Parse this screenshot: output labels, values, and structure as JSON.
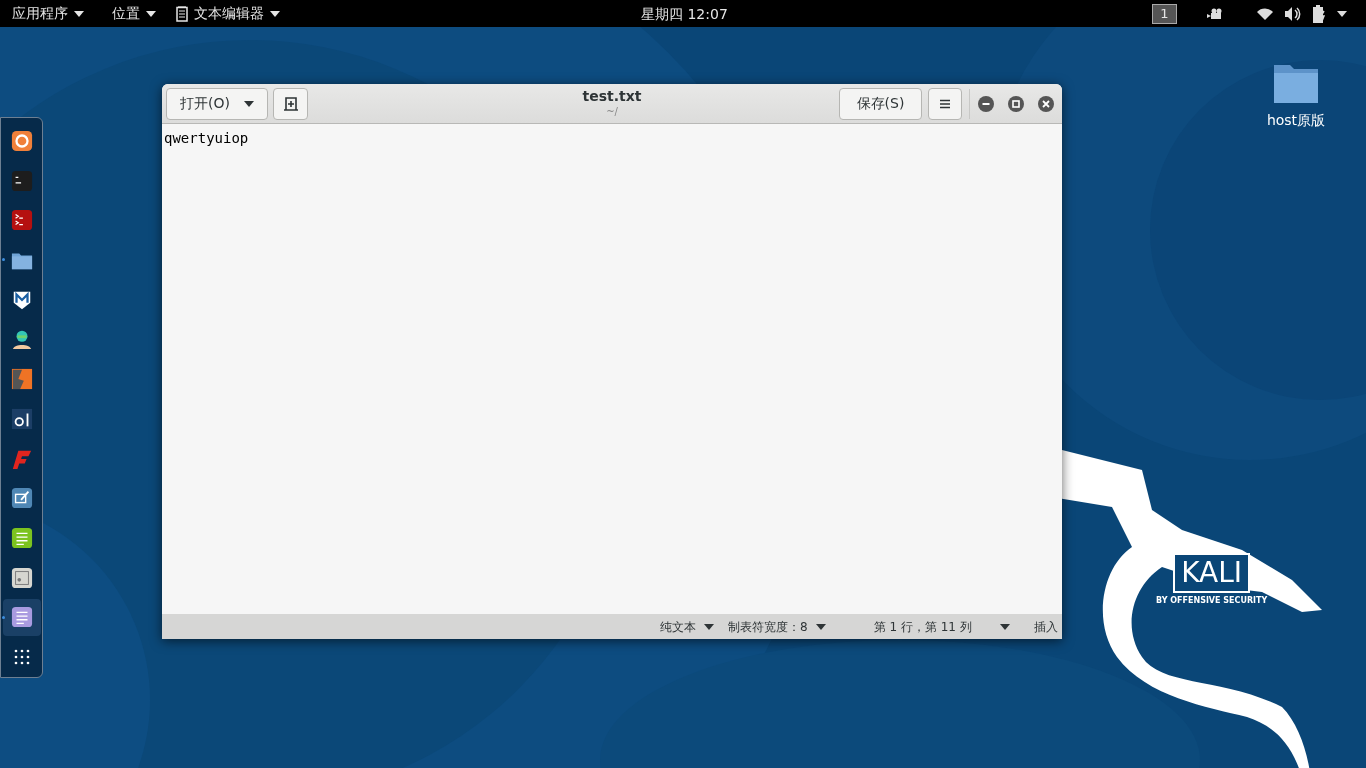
{
  "top_bar": {
    "menus": [
      {
        "label": "应用程序",
        "icon": false
      },
      {
        "label": "位置",
        "icon": false
      },
      {
        "label": "文本编辑器",
        "icon": true
      }
    ],
    "clock": "星期四 12:07",
    "workspace": "1"
  },
  "dock": {
    "items": [
      {
        "kind": "firefox",
        "running": false,
        "selected": false
      },
      {
        "kind": "terminal",
        "running": false,
        "selected": false
      },
      {
        "kind": "redterm",
        "running": false,
        "selected": false
      },
      {
        "kind": "files",
        "running": true,
        "selected": false
      },
      {
        "kind": "metasploit",
        "running": false,
        "selected": false
      },
      {
        "kind": "armitage",
        "running": false,
        "selected": false
      },
      {
        "kind": "burp",
        "running": false,
        "selected": false
      },
      {
        "kind": "beef",
        "running": false,
        "selected": false
      },
      {
        "kind": "faraday",
        "running": false,
        "selected": false
      },
      {
        "kind": "leafpad",
        "running": false,
        "selected": false
      },
      {
        "kind": "notes",
        "running": false,
        "selected": false
      },
      {
        "kind": "cutecom",
        "running": false,
        "selected": false
      },
      {
        "kind": "texteditor",
        "running": true,
        "selected": true
      },
      {
        "kind": "apps",
        "running": false,
        "selected": false
      }
    ]
  },
  "desktop_icons": [
    {
      "label": "host原版"
    }
  ],
  "wallpaper": {
    "logo": "KALI",
    "tagline": "BY OFFENSIVE SECURITY"
  },
  "window": {
    "title": "test.txt",
    "subtitle": "~/",
    "open_button": "打开(O)",
    "save_button": "保存(S)",
    "content": "qwertyuiop",
    "status_bar": {
      "language": "纯文本",
      "tab_width": "制表符宽度：8",
      "position": "第 1 行，第 11 列",
      "mode": "插入"
    }
  }
}
